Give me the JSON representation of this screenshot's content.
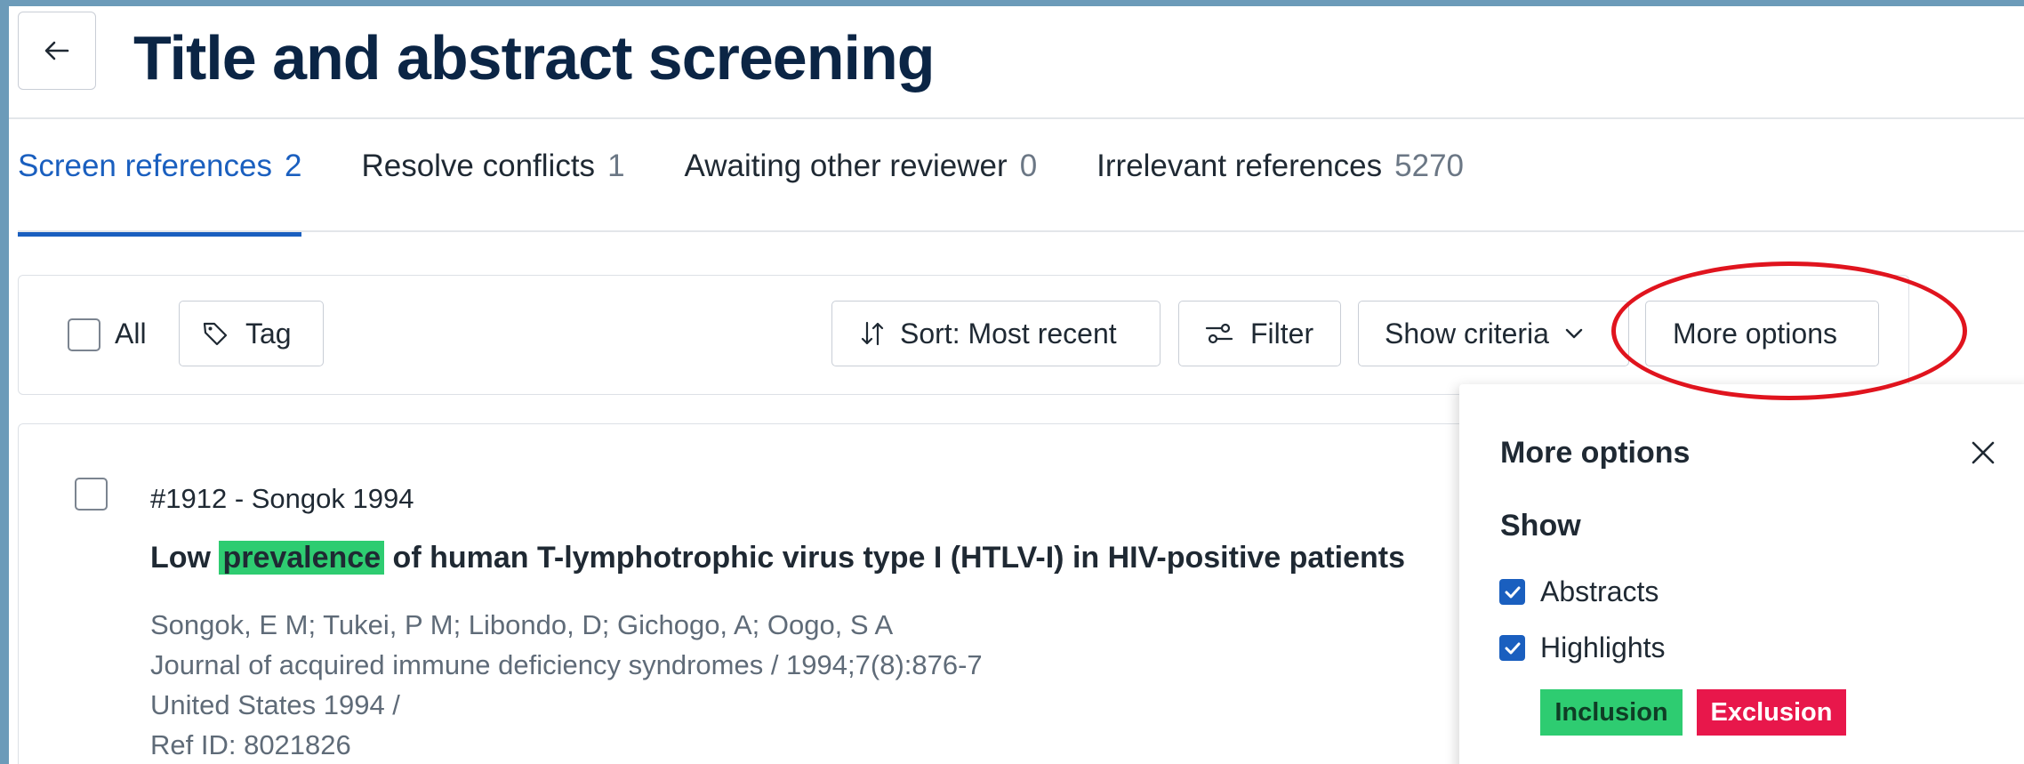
{
  "header": {
    "title": "Title and abstract screening"
  },
  "tabs": [
    {
      "label": "Screen references",
      "count": "2",
      "active": true
    },
    {
      "label": "Resolve conflicts",
      "count": "1"
    },
    {
      "label": "Awaiting other reviewer",
      "count": "0"
    },
    {
      "label": "Irrelevant references",
      "count": "5270"
    }
  ],
  "toolbar": {
    "select_all_label": "All",
    "tag_label": "Tag",
    "sort_label": "Sort: Most recent",
    "filter_label": "Filter",
    "show_criteria_label": "Show criteria",
    "more_options_label": "More options"
  },
  "reference": {
    "id_line": "#1912 - Songok 1994",
    "title_before": "Low ",
    "title_highlight": "prevalence",
    "title_after": " of human T-lymphotrophic virus type I (HTLV-I) in HIV-positive patients",
    "authors": "Songok, E M; Tukei, P M; Libondo, D; Gichogo, A; Oogo, S A",
    "journal": "Journal of acquired immune deficiency syndromes / 1994;7(8):876-7",
    "country_year": "United States 1994 /",
    "ref_id": "Ref ID: 8021826"
  },
  "more_options_panel": {
    "title": "More options",
    "show_heading": "Show",
    "options": [
      {
        "label": "Abstracts",
        "checked": true
      },
      {
        "label": "Highlights",
        "checked": true
      }
    ],
    "chips": {
      "inclusion": "Inclusion",
      "exclusion": "Exclusion"
    }
  },
  "colors": {
    "accent": "#1a5fbf",
    "title": "#0b2545",
    "inclusion": "#2ecc71",
    "exclusion": "#e8174b",
    "annotation": "#e0141e",
    "frame": "#6c9bb9"
  },
  "icons": [
    "back-arrow-icon",
    "tag-icon",
    "sort-icon",
    "filter-icon",
    "chevron-down-icon",
    "close-icon",
    "check-icon"
  ]
}
